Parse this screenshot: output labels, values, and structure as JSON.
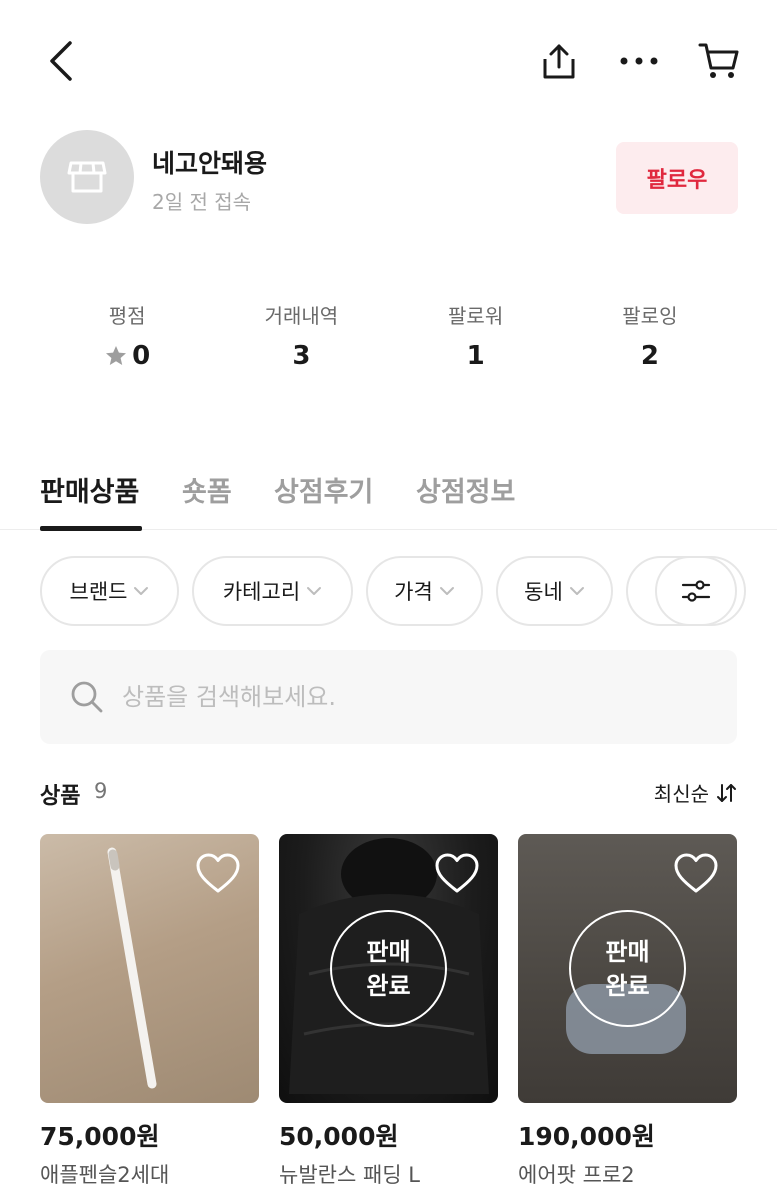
{
  "profile": {
    "store_name": "네고안돼용",
    "last_seen": "2일 전 접속",
    "follow_label": "팔로우"
  },
  "stats": [
    {
      "label": "평점",
      "value": "0",
      "icon": "star-icon"
    },
    {
      "label": "거래내역",
      "value": "3"
    },
    {
      "label": "팔로워",
      "value": "1"
    },
    {
      "label": "팔로잉",
      "value": "2"
    }
  ],
  "tabs": [
    {
      "label": "판매상품",
      "active": true
    },
    {
      "label": "숏폼"
    },
    {
      "label": "상점후기"
    },
    {
      "label": "상점정보"
    }
  ],
  "filters": [
    {
      "label": "브랜드"
    },
    {
      "label": "카테고리"
    },
    {
      "label": "가격"
    },
    {
      "label": "동네"
    }
  ],
  "search": {
    "placeholder": "상품을 검색해보세요."
  },
  "list": {
    "count_label": "상품",
    "count": "9",
    "sort_label": "최신순"
  },
  "products": [
    {
      "price": "75,000원",
      "name": "애플펜슬2세대",
      "sold": false
    },
    {
      "price": "50,000원",
      "name": "뉴발란스 패딩 L",
      "sold": true,
      "sold_label_1": "판매",
      "sold_label_2": "완료"
    },
    {
      "price": "190,000원",
      "name": "에어팟 프로2",
      "sold": true,
      "sold_label_1": "판매",
      "sold_label_2": "완료"
    }
  ],
  "colors": {
    "accent": "#e0283e",
    "follow_bg": "#fdecee",
    "text": "#1a1a1a",
    "muted": "#9e9e9e"
  }
}
